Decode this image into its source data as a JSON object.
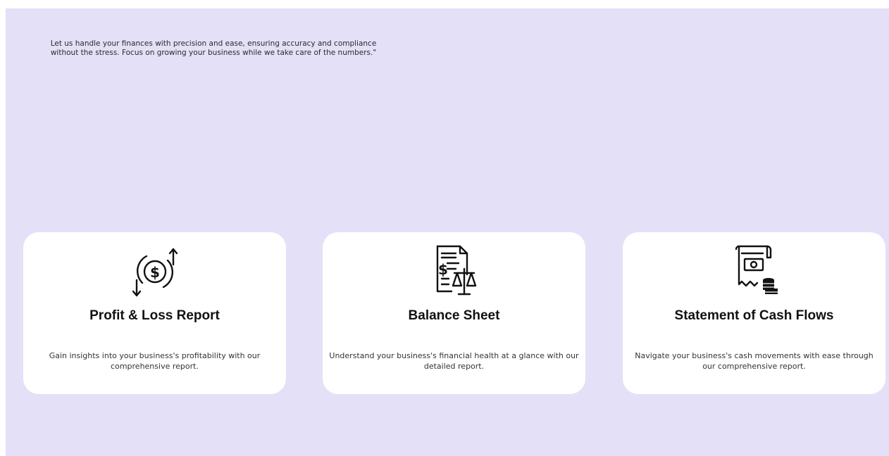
{
  "intro": {
    "text": "Let us handle your finances with precision and ease, ensuring accuracy and compliance without the stress. Focus on growing your business while we take care of the numbers.\""
  },
  "cards": [
    {
      "icon": "dollar-exchange-icon",
      "title": "Profit & Loss Report",
      "description": "Gain insights into your business's profitability with our comprehensive report."
    },
    {
      "icon": "balance-sheet-scale-icon",
      "title": "Balance Sheet",
      "description": "Understand your business's financial health at a glance with our detailed report."
    },
    {
      "icon": "cash-flow-receipt-icon",
      "title": "Statement of Cash Flows",
      "description": "Navigate your business's cash movements with ease through our comprehensive report."
    }
  ],
  "colors": {
    "background": "#e4e0f8",
    "card": "#ffffff",
    "text": "#111111"
  }
}
